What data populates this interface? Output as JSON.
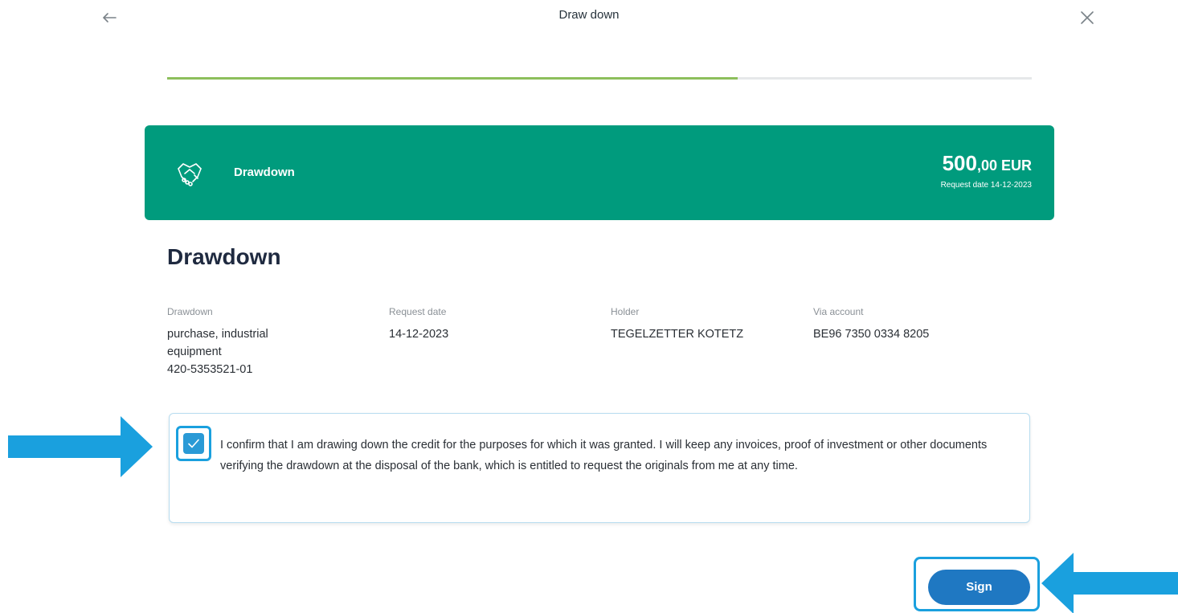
{
  "header": {
    "title": "Draw down",
    "back_icon": "arrow-left-icon",
    "close_icon": "close-icon"
  },
  "progress": {
    "fraction": 0.66
  },
  "summary": {
    "icon": "handshake-icon",
    "label": "Drawdown",
    "amount_main": "500",
    "amount_rest": ",00 EUR",
    "request_line": "Request date 14-12-2023"
  },
  "section": {
    "heading": "Drawdown"
  },
  "details": [
    {
      "label": "Drawdown",
      "lines": [
        "purchase, industrial",
        "equipment",
        "420-5353521-01"
      ]
    },
    {
      "label": "Request date",
      "lines": [
        "14-12-2023"
      ]
    },
    {
      "label": "Holder",
      "lines": [
        "TEGELZETTER KOTETZ"
      ]
    },
    {
      "label": "Via account",
      "lines": [
        "BE96 7350 0334 8205"
      ]
    }
  ],
  "confirm": {
    "checked": true,
    "text": "I confirm that I am drawing down the credit for the purposes for which it was granted. I will keep any invoices, proof of investment or other documents verifying the drawdown at the disposal of the bank, which is entitled to request the originals from me at any time."
  },
  "actions": {
    "sign_label": "Sign"
  },
  "colors": {
    "accent_green": "#009b7d",
    "progress_green": "#8dbf5c",
    "primary_blue": "#1f78c2",
    "annotation_blue": "#1aa0de"
  }
}
